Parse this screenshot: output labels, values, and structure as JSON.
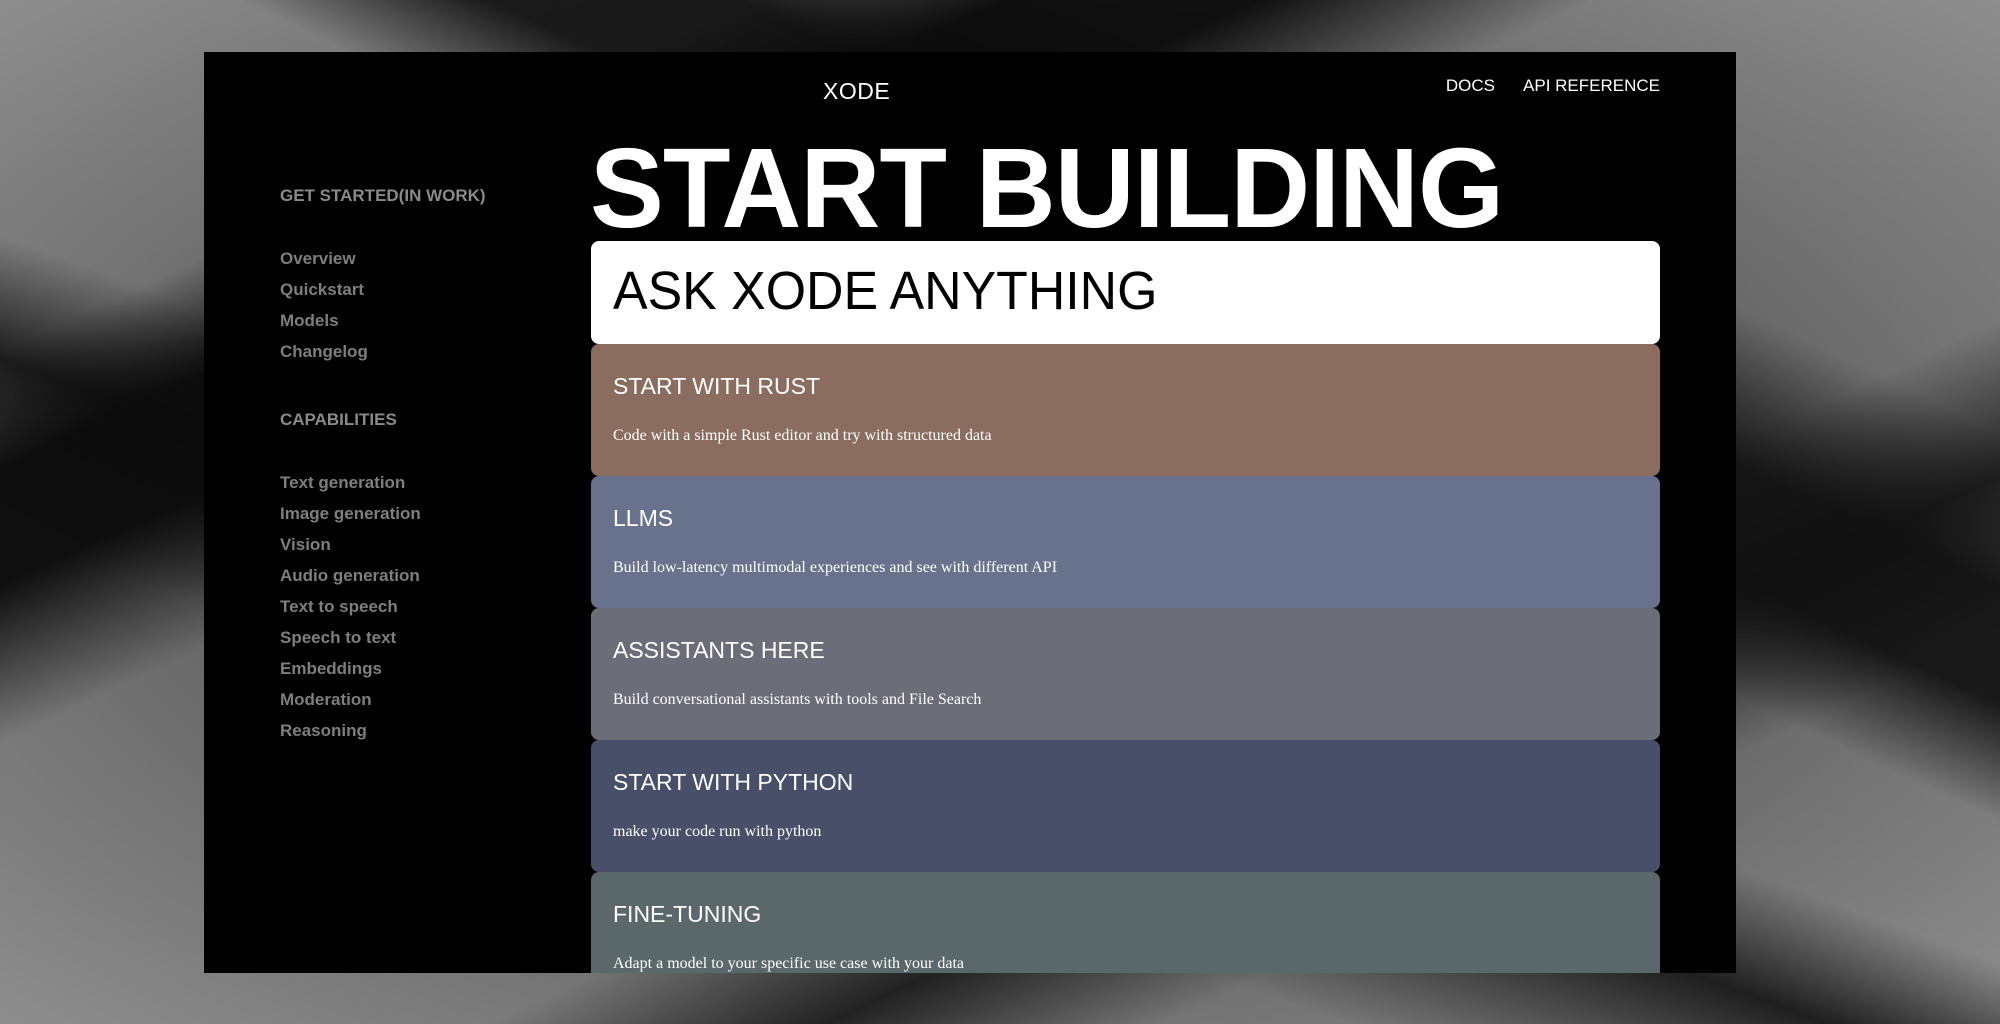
{
  "header": {
    "brand": "XODE",
    "nav": [
      {
        "label": "DOCS"
      },
      {
        "label": "API REFERENCE"
      }
    ]
  },
  "sidebar": {
    "groups": [
      {
        "heading": "GET STARTED(IN WORK)",
        "items": [
          "Overview",
          "Quickstart",
          "Models",
          "Changelog"
        ]
      },
      {
        "heading": "CAPABILITIES",
        "items": [
          "Text generation",
          "Image generation",
          "Vision",
          "Audio generation",
          "Text to speech",
          "Speech to text",
          "Embeddings",
          "Moderation",
          "Reasoning"
        ]
      }
    ]
  },
  "main": {
    "hero_title": "START BUILDING",
    "ask_prompt": "ASK XODE ANYTHING",
    "cards": [
      {
        "title": "START WITH RUST",
        "description": "Code with a simple Rust editor and try with structured data",
        "color": "#8a6d5e"
      },
      {
        "title": "LLMS",
        "description": "Build low-latency multimodal experiences and see with different API",
        "color": "#68728d"
      },
      {
        "title": "ASSISTANTS HERE",
        "description": "Build conversational assistants with tools and File Search",
        "color": "#6b6e79"
      },
      {
        "title": "START WITH PYTHON",
        "description": "make your code run with python",
        "color": "#474f69"
      },
      {
        "title": "FINE-TUNING",
        "description": "Adapt a model to your specific use case with your data",
        "color": "#5a676b"
      }
    ]
  },
  "colors": {
    "frame_background": "#000000",
    "ask_card_background": "#ffffff",
    "sidebar_text": "#7e7e7e",
    "sidebar_heading": "#8a8a8a"
  }
}
